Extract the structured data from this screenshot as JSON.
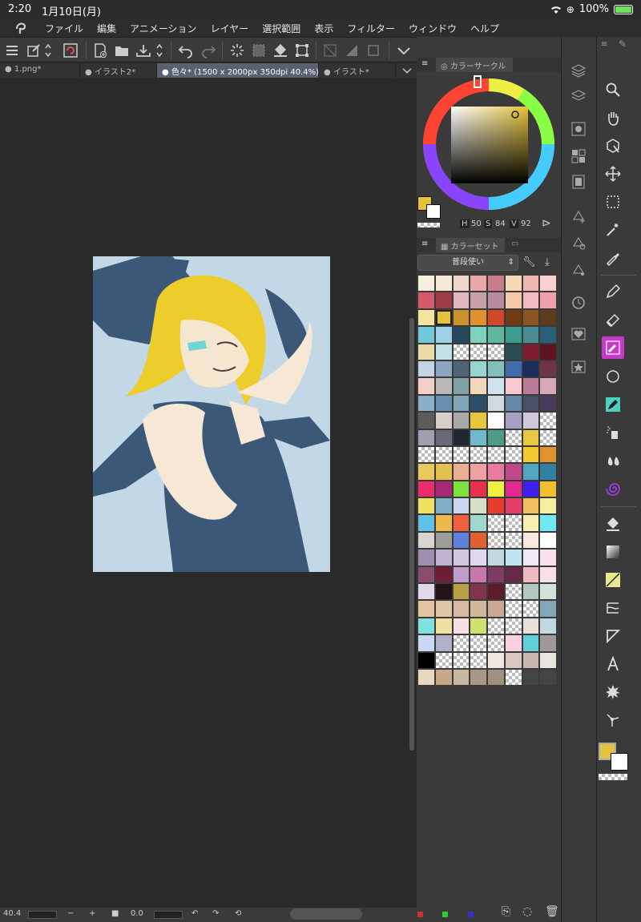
{
  "status": {
    "time": "2:20",
    "date": "1月10日(月)",
    "battery": "100%"
  },
  "menu": [
    "ファイル",
    "編集",
    "アニメーション",
    "レイヤー",
    "選択範囲",
    "表示",
    "フィルター",
    "ウィンドウ",
    "ヘルプ"
  ],
  "tabs": [
    {
      "label": "1.png*",
      "active": false
    },
    {
      "label": "イラスト2*",
      "active": false
    },
    {
      "label": "色々* (1500 x 2000px 350dpi 40.4%)",
      "active": true
    },
    {
      "label": "イラスト*",
      "active": false
    }
  ],
  "color_circle": {
    "title": "カラーサークル",
    "h_label": "H",
    "h": "50",
    "s_label": "S",
    "s": "84",
    "v_label": "V",
    "v": "92"
  },
  "color_set": {
    "title": "カラーセット",
    "selected_set": "普段使い"
  },
  "bottom": {
    "zoom": "40.4",
    "minus": "−",
    "plus": "+",
    "rotation": "0.0"
  },
  "colors": {
    "main": "#e4c23a",
    "sub": "#ffffff",
    "accent_tool": "#c33bc7",
    "tab_active": "#596070"
  },
  "palette": [
    "#f7eedd",
    "#f6e8d8",
    "#f0d6cc",
    "#e8a8a8",
    "#c87e8c",
    "#f5d9b6",
    "#f0b8b0",
    "#f8d0d0",
    "#d45a6a",
    "#a03c44",
    "#e0b8c0",
    "#c8a0a8",
    "#b88ca0",
    "#f6c8a8",
    "#f3b8c0",
    "#f0a0a8",
    "#f4e4a0",
    "#e4c23a",
    "#c8922c",
    "#e09030",
    "#d04828",
    "#6c3c14",
    "#8c5424",
    "#5c3c1c",
    "#70c8d8",
    "#a0d0e8",
    "#284860",
    "#80d0c0",
    "#60b8a0",
    "#3c9c8c",
    "#4c8c94",
    "#2c6078",
    "#e8dca8",
    "#c0e0e4",
    "CHK",
    "CHK",
    "CHK",
    "#2c4c54",
    "#7c1c2c",
    "#5c1424",
    "#c0d4e4",
    "#8ca4c0",
    "#506478",
    "#98d4d0",
    "#80c0b8",
    "#406cac",
    "#1c2c5c",
    "#6c3444",
    "#f0d0c8",
    "#b8b8b8",
    "#80a0a4",
    "#f0d8b8",
    "#d0e4f0",
    "#f8c8d0",
    "#b87c98",
    "#d8a8b8",
    "#88b0c8",
    "#6890b0",
    "#80a4b8",
    "#2c4c68",
    "#d0d8e0",
    "#6888a8",
    "#485068",
    "#483c5c",
    "#5c5c5c",
    "#d8d0c8",
    "#a8a8a8",
    "#e4c83a",
    "#ffffff",
    "#a8a0c4",
    "#d0c8d8",
    "CHK",
    "#a0a0b0",
    "#686878",
    "#202830",
    "#70b8cc",
    "#4c9c88",
    "CHK",
    "#e8c840",
    "CHK",
    "CHK",
    "CHK",
    "CHK",
    "CHK",
    "CHK",
    "CHK",
    "#f0c830",
    "#e09430",
    "#e8c860",
    "#e4c050",
    "#e8b090",
    "#f0a0a0",
    "#e87ca0",
    "#c04888",
    "#50a8c0",
    "#3080a0",
    "#e82c6c",
    "#a82878",
    "#80e040",
    "#e8304c",
    "#f0f040",
    "#e02c8c",
    "#4020f0",
    "#f0c030",
    "#f0e060",
    "#80b0c8",
    "#c8d8f0",
    "#d8e0c8",
    "#e83c2c",
    "#e83c6c",
    "#f0c060",
    "#f4f0a0",
    "#60c0e8",
    "#f0b848",
    "#f06040",
    "#a0d8d0",
    "CHK",
    "CHK",
    "#f8f0b0",
    "#70e8f0",
    "#d8d4d0",
    "#9c9c98",
    "#6080e0",
    "#e06030",
    "CHK",
    "CHK",
    "#f8e8e0",
    "#ffffff",
    "#a090b0",
    "#c0b4d0",
    "#d0c8e0",
    "#e0d8f0",
    "#c0d8e0",
    "#c0e4f0",
    "#f0e8f4",
    "#f8e0ec",
    "#8c4c6c",
    "#6c1c34",
    "#c09cc8",
    "#c878a8",
    "#7c3c64",
    "#682848",
    "#f0b8c0",
    "#f8e0e8",
    "#e0d8e8",
    "#201418",
    "#b8a048",
    "#803450",
    "#5c1c2c",
    "CHK",
    "#b0c8c0",
    "#d0e4dc",
    "#e4c4a0",
    "#e0c4a8",
    "#d8b8a0",
    "#d0b898",
    "#c8a890",
    "CHK",
    "CHK",
    "#80a8b8",
    "#80e0e0",
    "#f0e0a0",
    "#f8e0e0",
    "#d0e070",
    "CHK",
    "CHK",
    "#e8e0d8",
    "#c0d8e0",
    "#c8d8f4",
    "#b0b0c8",
    "CHK",
    "CHK",
    "CHK",
    "#f8d0e0",
    "#60d0d8",
    "#a09898",
    "#000000",
    "CHK",
    "CHK",
    "CHK",
    "#f0e8e0",
    "#d8c8c0",
    "#c8b8b0",
    "#e8e4e0",
    "#e8d8c0",
    "#c8a888",
    "#c8b8a0",
    "#a89888",
    "#a09080",
    "CHK",
    "#444444",
    "#444444"
  ]
}
